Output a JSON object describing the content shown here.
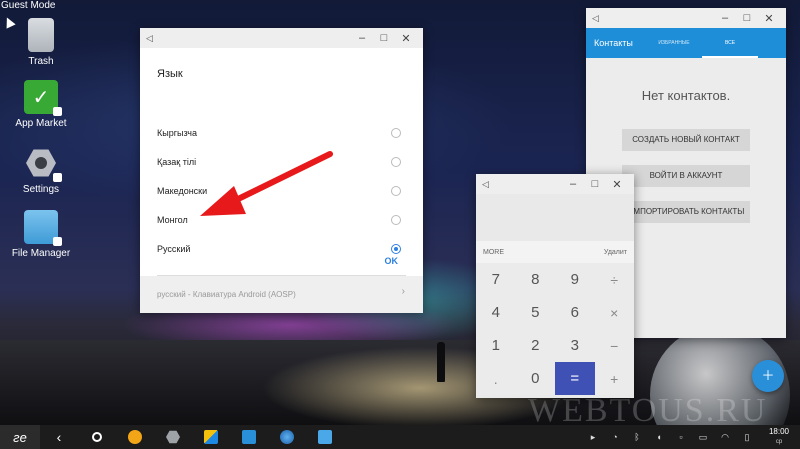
{
  "system": {
    "guest_mode": "Guest Mode"
  },
  "desktop_icons": [
    {
      "label": "Trash"
    },
    {
      "label": "App Market"
    },
    {
      "label": "Settings"
    },
    {
      "label": "File Manager"
    }
  ],
  "language_dialog": {
    "title": "Язык",
    "options": [
      {
        "label": "Кыргызча",
        "selected": false
      },
      {
        "label": "Қазақ тілі",
        "selected": false
      },
      {
        "label": "Македонски",
        "selected": false
      },
      {
        "label": "Монгол",
        "selected": false
      },
      {
        "label": "Русский",
        "selected": true
      }
    ],
    "ok_label": "OK",
    "behind_item_subtitle": "русский - Клавиатура Android (AOSP)"
  },
  "contacts": {
    "title": "Контакты",
    "tabs": [
      "ИЗБРАННЫЕ",
      "ВСЕ"
    ],
    "active_tab": "ВСЕ",
    "empty_text": "Нет контактов.",
    "buttons": [
      "СОЗДАТЬ НОВЫЙ КОНТАКТ",
      "ВОЙТИ В АККАУНТ",
      "ИМПОРТИРОВАТЬ КОНТАКТЫ"
    ]
  },
  "calculator": {
    "mode_left": "MORE",
    "mode_right": "Удалит",
    "keys": [
      "7",
      "8",
      "9",
      "÷",
      "4",
      "5",
      "6",
      "×",
      "1",
      "2",
      "3",
      "−",
      ".",
      "0",
      "=",
      "+"
    ]
  },
  "watermark": "WEBTOUS.RU",
  "taskbar": {
    "clock_time": "18:00",
    "clock_day": "ср"
  },
  "colors": {
    "accent_blue": "#1e8ed8",
    "radio_blue": "#2e80e0",
    "calc_equals": "#3f51b5",
    "arrow_red": "#e8191b"
  }
}
